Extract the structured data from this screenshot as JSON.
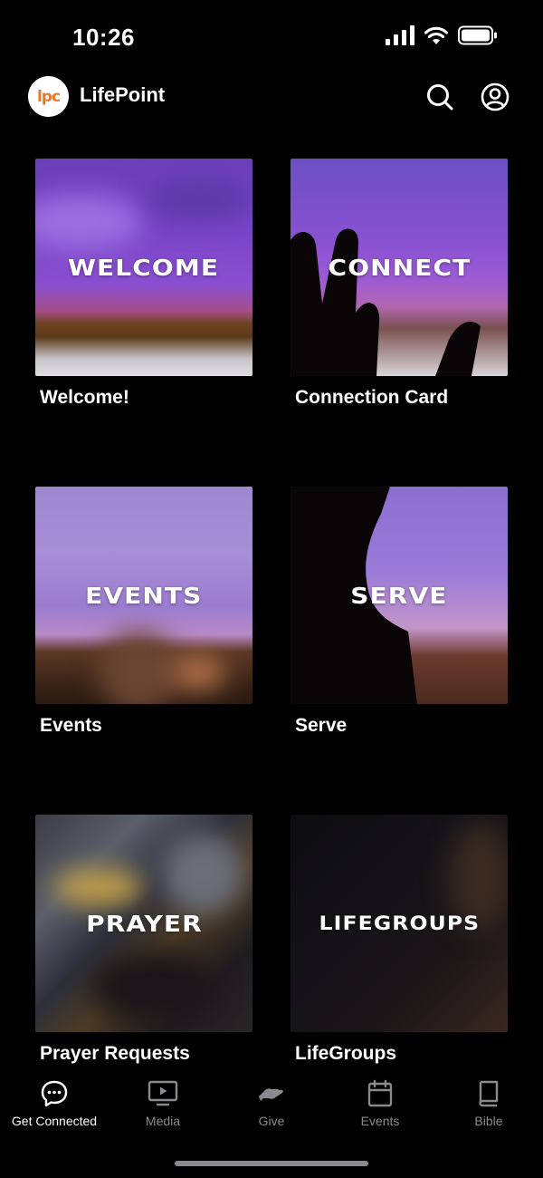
{
  "status_bar": {
    "time": "10:26"
  },
  "header": {
    "logo_text": "lpc",
    "title": "LifePoint"
  },
  "tiles": [
    {
      "overlay": "WELCOME",
      "label": "Welcome!"
    },
    {
      "overlay": "CONNECT",
      "label": "Connection Card"
    },
    {
      "overlay": "EVENTS",
      "label": "Events"
    },
    {
      "overlay": "SERVE",
      "label": "Serve"
    },
    {
      "overlay": "PRAYER",
      "label": "Prayer Requests"
    },
    {
      "overlay": "LIFEGROUPS",
      "label": "LifeGroups"
    }
  ],
  "tab_bar": [
    {
      "label": "Get Connected",
      "icon": "chat-bubble-icon",
      "active": true
    },
    {
      "label": "Media",
      "icon": "play-monitor-icon",
      "active": false
    },
    {
      "label": "Give",
      "icon": "giving-hand-icon",
      "active": false
    },
    {
      "label": "Events",
      "icon": "calendar-icon",
      "active": false
    },
    {
      "label": "Bible",
      "icon": "book-icon",
      "active": false
    }
  ],
  "colors": {
    "background": "#000000",
    "logo_accent": "#e8772e",
    "inactive_tab": "#8a8a8e",
    "active_tab": "#ffffff"
  }
}
